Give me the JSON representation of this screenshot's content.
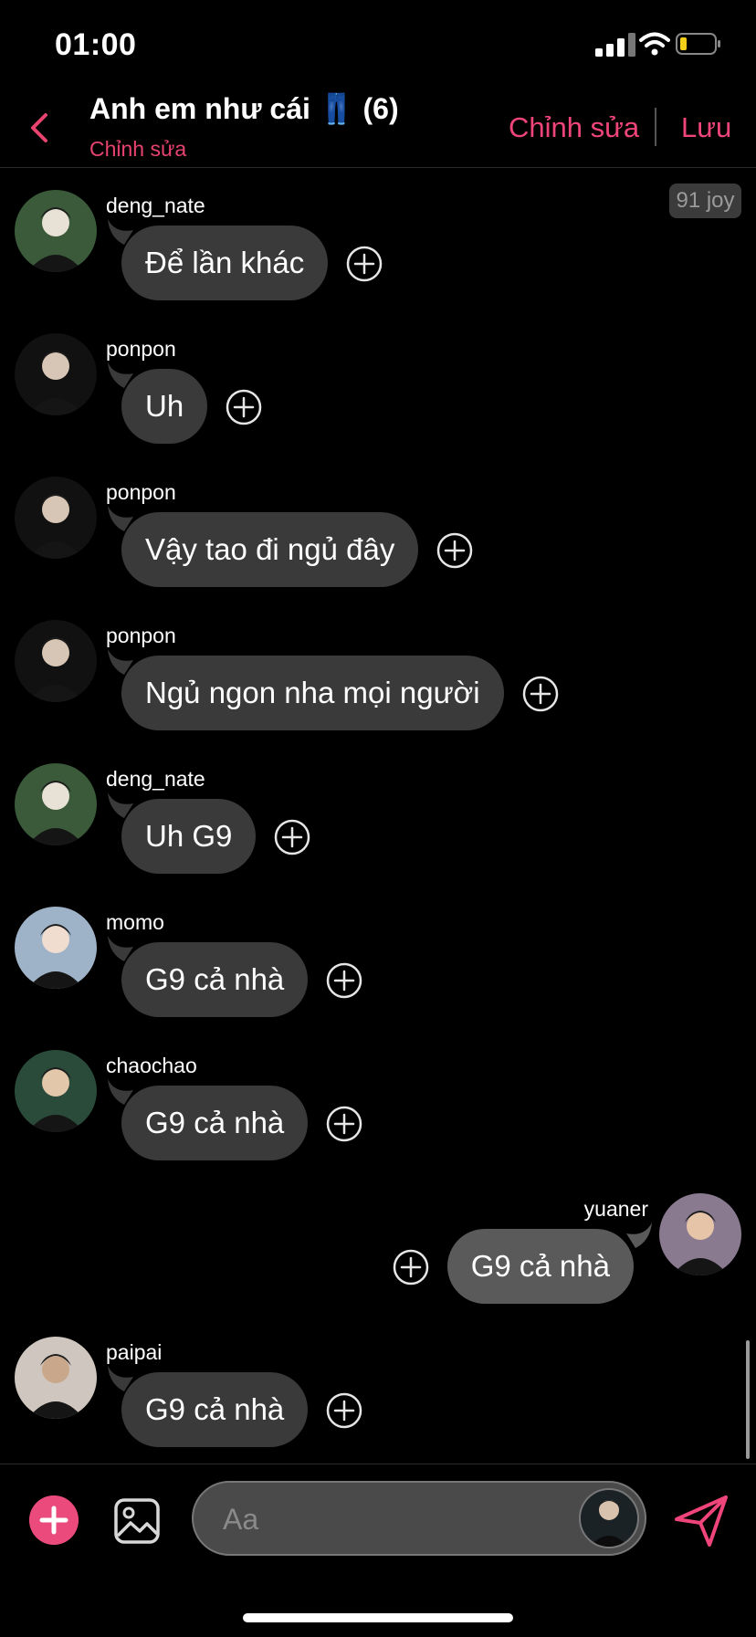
{
  "status_bar": {
    "time": "01:00"
  },
  "header": {
    "title": "Anh em như cái 👖 (6)",
    "subtitle": "Chỉnh sửa",
    "edit_label": "Chỉnh sửa",
    "save_label": "Lưu"
  },
  "badge": "91 joy",
  "messages": [
    {
      "sender": "deng_nate",
      "text": "Để lần khác",
      "side": "in"
    },
    {
      "sender": "ponpon",
      "text": "Uh",
      "side": "in"
    },
    {
      "sender": "ponpon",
      "text": "Vậy tao đi ngủ đây",
      "side": "in"
    },
    {
      "sender": "ponpon",
      "text": "Ngủ ngon nha mọi người",
      "side": "in"
    },
    {
      "sender": "deng_nate",
      "text": "Uh G9",
      "side": "in"
    },
    {
      "sender": "momo",
      "text": "G9 cả nhà",
      "side": "in"
    },
    {
      "sender": "chaochao",
      "text": "G9 cả nhà",
      "side": "in"
    },
    {
      "sender": "yuaner",
      "text": "G9 cả nhà",
      "side": "out"
    },
    {
      "sender": "paipai",
      "text": "G9 cả nhà",
      "side": "in"
    }
  ],
  "composer": {
    "placeholder": "Aa"
  },
  "colors": {
    "accent": "#f0457a",
    "bubble_in": "#3a3a3a",
    "bubble_out": "#5a5a5a",
    "background": "#000000"
  },
  "icons": [
    "back-chevron-icon",
    "signal-icon",
    "wifi-icon",
    "battery-icon",
    "add-reaction-icon",
    "plus-icon",
    "image-icon",
    "send-icon"
  ]
}
